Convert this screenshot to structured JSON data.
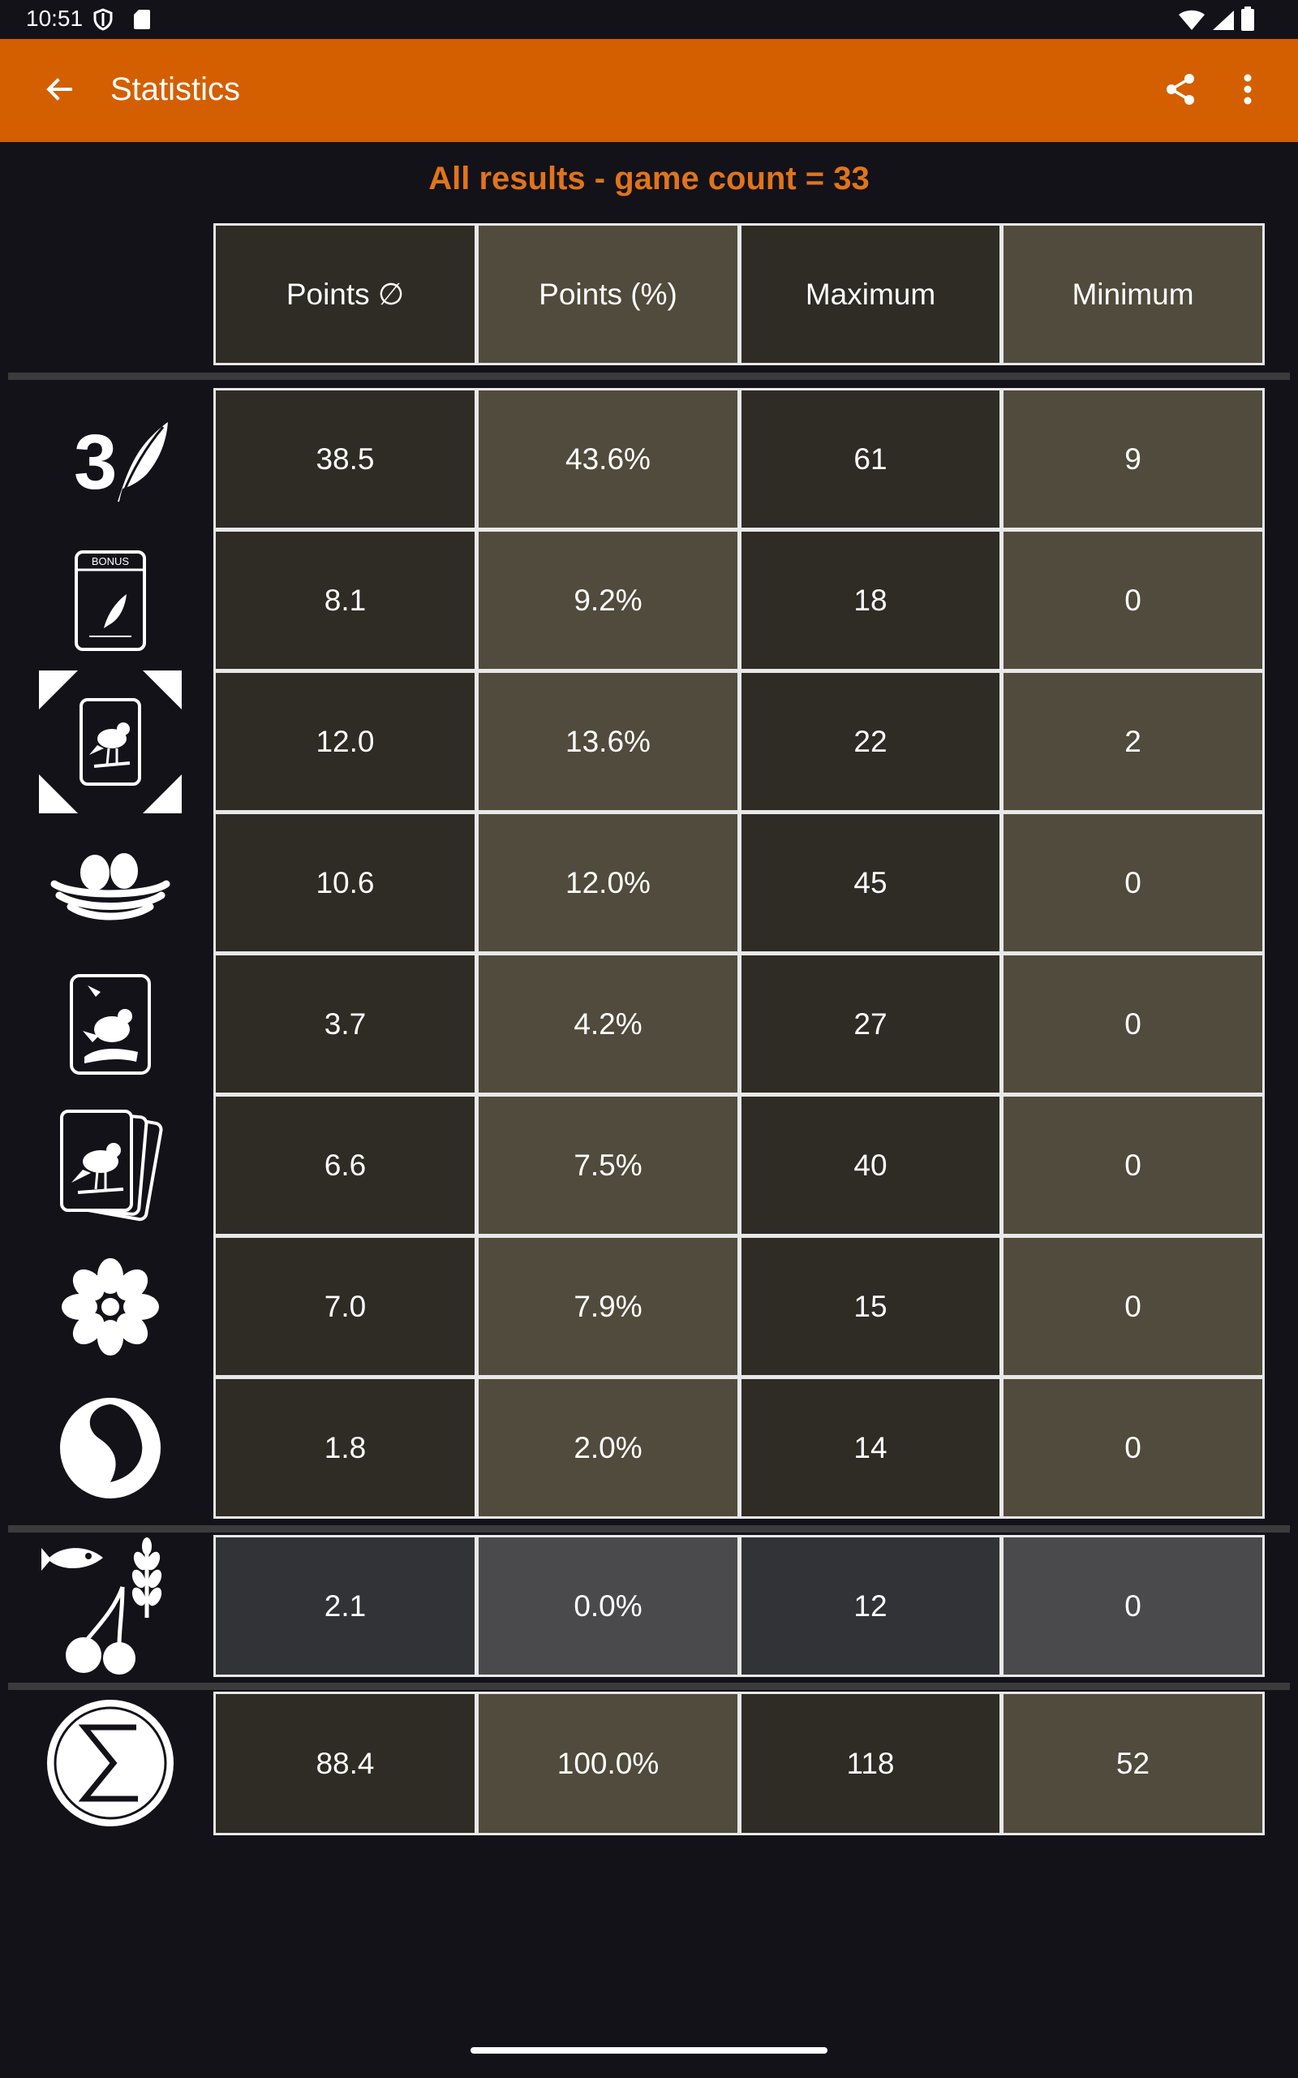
{
  "status_bar": {
    "time": "10:51",
    "left_icons": [
      "shield-icon",
      "sd-card-icon"
    ],
    "right_icons": [
      "wifi-icon",
      "signal-icon",
      "battery-icon"
    ]
  },
  "app_bar": {
    "title": "Statistics",
    "background_color": "#D35F00",
    "actions": [
      "share-icon",
      "more-vert-icon"
    ]
  },
  "heading": "All results - game count = 33",
  "heading_color": "#E0741C",
  "table": {
    "columns": [
      "Points ∅",
      "Points (%)",
      "Maximum",
      "Minimum"
    ],
    "rows": [
      {
        "icon": "feather-3-icon",
        "cells": [
          "38.5",
          "43.6%",
          "61",
          "9"
        ]
      },
      {
        "icon": "bonus-card-icon",
        "cells": [
          "8.1",
          "9.2%",
          "18",
          "0"
        ]
      },
      {
        "icon": "end-of-round-goal-icon",
        "cells": [
          "12.0",
          "13.6%",
          "22",
          "2"
        ]
      },
      {
        "icon": "nest-eggs-icon",
        "cells": [
          "10.6",
          "12.0%",
          "45",
          "0"
        ]
      },
      {
        "icon": "cached-food-icon",
        "cells": [
          "3.7",
          "4.2%",
          "27",
          "0"
        ]
      },
      {
        "icon": "tucked-cards-icon",
        "cells": [
          "6.6",
          "7.5%",
          "40",
          "0"
        ]
      },
      {
        "icon": "nectar-flower-icon",
        "cells": [
          "7.0",
          "7.9%",
          "15",
          "0"
        ]
      },
      {
        "icon": "duet-token-icon",
        "cells": [
          "1.8",
          "2.0%",
          "14",
          "0"
        ]
      },
      {
        "icon": "leftover-food-icon",
        "cells": [
          "2.1",
          "0.0%",
          "12",
          "0"
        ]
      },
      {
        "icon": "sum-icon",
        "cells": [
          "88.4",
          "100.0%",
          "118",
          "52"
        ]
      }
    ]
  }
}
